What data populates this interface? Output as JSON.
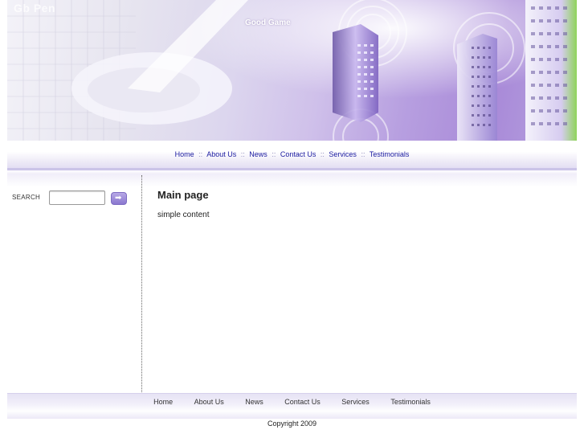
{
  "header": {
    "site_name": "Gb Pen",
    "tagline": "Good Game"
  },
  "top_nav": {
    "items": [
      "Home",
      "About Us",
      "News",
      "Contact Us",
      "Services",
      "Testimonials"
    ],
    "separator": "::"
  },
  "sidebar": {
    "search_label": "SEARCH",
    "search_value": "",
    "search_button_icon": "arrow-right-icon"
  },
  "main": {
    "title": "Main page",
    "body": "simple content"
  },
  "bottom_nav": {
    "items": [
      "Home",
      "About Us",
      "News",
      "Contact Us",
      "Services",
      "Testimonials"
    ]
  },
  "footer": {
    "copyright": "Copyright 2009"
  },
  "colors": {
    "accent": "#8a77cf",
    "nav_link": "#1a1aa0",
    "banner_purple": "#a98ad8"
  }
}
